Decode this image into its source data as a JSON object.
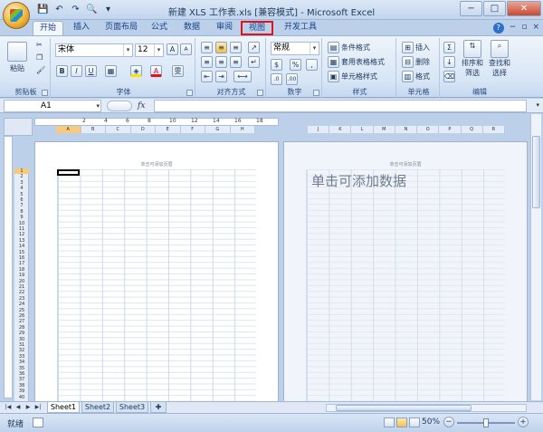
{
  "window": {
    "title": "新建 XLS 工作表.xls  [兼容模式] - Microsoft Excel",
    "minimize": "−",
    "maximize": "□",
    "close": "✕"
  },
  "qat": {
    "save": "💾",
    "undo": "↶",
    "redo": "↷",
    "preview": "🔍",
    "more": "▾"
  },
  "tabs": [
    {
      "label": "开始",
      "active": true
    },
    {
      "label": "插入"
    },
    {
      "label": "页面布局"
    },
    {
      "label": "公式"
    },
    {
      "label": "数据"
    },
    {
      "label": "审阅"
    },
    {
      "label": "视图",
      "highlighted": true
    },
    {
      "label": "开发工具"
    }
  ],
  "ribbon": {
    "clipboard": {
      "label": "剪贴板",
      "paste": "粘贴",
      "cut": "✂",
      "copy": "❐",
      "format_painter": "🖌"
    },
    "font": {
      "label": "字体",
      "font_name": "宋体",
      "font_size": "12",
      "grow": "A",
      "shrink": "A",
      "bold": "B",
      "italic": "I",
      "underline": "U",
      "border": "▦",
      "fill": "◈",
      "color": "A",
      "phonetic": "雯"
    },
    "alignment": {
      "label": "对齐方式"
    },
    "number": {
      "label": "数字",
      "format": "常规",
      "currency": "$",
      "percent": "%",
      "comma": ","
    },
    "styles": {
      "label": "样式",
      "conditional": "条件格式",
      "table": "套用表格格式",
      "cell": "单元格样式"
    },
    "cells": {
      "label": "单元格",
      "insert": "插入",
      "delete": "删除",
      "format": "格式"
    },
    "editing": {
      "label": "编辑",
      "sum": "Σ",
      "sort": "排序和",
      "sort2": "筛选",
      "find": "查找和",
      "find2": "选择"
    }
  },
  "formula_bar": {
    "cell_ref": "A1",
    "fx": "fx",
    "value": ""
  },
  "ruler": {
    "numbers": [
      "2",
      "4",
      "6",
      "8",
      "10",
      "12",
      "14",
      "16",
      "18"
    ]
  },
  "columns_page1": [
    "A",
    "B",
    "C",
    "D",
    "E",
    "F",
    "G",
    "H"
  ],
  "columns_page2": [
    "J",
    "K",
    "L",
    "M",
    "N",
    "O",
    "P",
    "Q",
    "R"
  ],
  "rows": [
    "1",
    "2",
    "3",
    "4",
    "5",
    "6",
    "7",
    "8",
    "9",
    "10",
    "11",
    "12",
    "13",
    "14",
    "15",
    "16",
    "17",
    "18",
    "19",
    "20",
    "21",
    "22",
    "23",
    "24",
    "25",
    "26",
    "27",
    "28",
    "29",
    "30",
    "31",
    "32",
    "33",
    "34",
    "35",
    "36",
    "37",
    "38",
    "39",
    "40"
  ],
  "page1": {
    "header_hint": "单击可添加页眉"
  },
  "page2": {
    "header_hint": "单击可添加页眉",
    "data_hint": "单击可添加数据"
  },
  "sheets": [
    {
      "label": "Sheet1",
      "active": true
    },
    {
      "label": "Sheet2"
    },
    {
      "label": "Sheet3"
    }
  ],
  "status": {
    "ready": "就绪",
    "zoom": "50%",
    "zoom_level_pct": 50
  }
}
